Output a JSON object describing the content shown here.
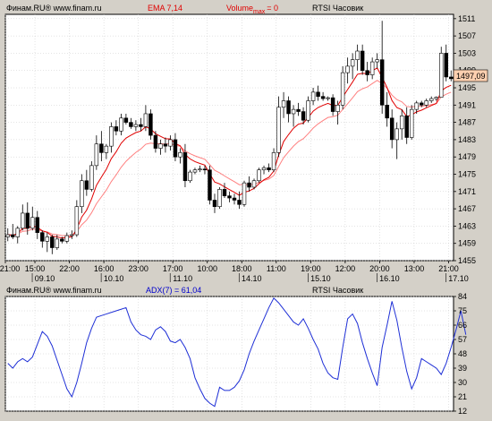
{
  "colors": {
    "background": "#d4d0c8",
    "plot_bg": "#ffffff",
    "grid": "#c8c8c8",
    "candle": "#000000",
    "ema": "#e00000",
    "ema_outer": "#ff8080",
    "adx": "#1e2fd6",
    "header_red": "#e00000",
    "header_blue": "#0000cc",
    "price_marker": "#ffd0b0"
  },
  "chart_data": [
    {
      "type": "candlestick",
      "header": {
        "source": "Финам.RU® www.finam.ru",
        "indicator": "EMA 7,14",
        "volume_prefix": "Volume",
        "volume_sub": "max",
        "volume_suffix": "= 0",
        "instrument": "RTSI Часовик"
      },
      "last_price": "1497,09",
      "ylim": [
        1455,
        1512
      ],
      "yticks": [
        1455,
        1459,
        1463,
        1467,
        1471,
        1475,
        1479,
        1483,
        1487,
        1491,
        1495,
        1499,
        1503,
        1507,
        1511
      ],
      "ytick_labels": [
        "1455",
        "1459",
        "1463",
        "1467",
        "1471",
        "1475",
        "1479",
        "1483",
        "1487",
        "1491",
        "1495",
        "1499",
        "1503",
        "1507",
        "1511"
      ],
      "xticks": [
        "21:00",
        "15:00",
        "22:00",
        "16:00",
        "23:00",
        "17:00",
        "10:00",
        "18:00",
        "11:00",
        "19:00",
        "12:00",
        "20:00",
        "13:00",
        "21:00"
      ],
      "xtick_positions": [
        0,
        6,
        13,
        20,
        27,
        34,
        41,
        48,
        55,
        62,
        69,
        76,
        83,
        90
      ],
      "date_labels": [
        "09.10",
        "10.10",
        "11.10",
        "14.10",
        "15.10",
        "16.10",
        "17.10"
      ],
      "date_positions": [
        8,
        22,
        36,
        50,
        64,
        78,
        92
      ],
      "candles": [
        {
          "o": 1460.5,
          "h": 1462.5,
          "l": 1459.5,
          "c": 1461.0
        },
        {
          "o": 1461.0,
          "h": 1463.5,
          "l": 1460.0,
          "c": 1460.5
        },
        {
          "o": 1460.5,
          "h": 1463.0,
          "l": 1459.0,
          "c": 1462.5
        },
        {
          "o": 1462.5,
          "h": 1468.0,
          "l": 1462.0,
          "c": 1466.0
        },
        {
          "o": 1466.0,
          "h": 1468.5,
          "l": 1461.0,
          "c": 1462.5
        },
        {
          "o": 1462.5,
          "h": 1467.5,
          "l": 1462.0,
          "c": 1465.0
        },
        {
          "o": 1465.0,
          "h": 1466.5,
          "l": 1460.0,
          "c": 1461.5
        },
        {
          "o": 1461.5,
          "h": 1462.0,
          "l": 1458.0,
          "c": 1459.5
        },
        {
          "o": 1459.5,
          "h": 1461.5,
          "l": 1457.0,
          "c": 1460.5
        },
        {
          "o": 1460.5,
          "h": 1461.0,
          "l": 1456.5,
          "c": 1458.0
        },
        {
          "o": 1458.0,
          "h": 1461.0,
          "l": 1457.5,
          "c": 1460.0
        },
        {
          "o": 1460.0,
          "h": 1460.5,
          "l": 1459.0,
          "c": 1459.5
        },
        {
          "o": 1459.5,
          "h": 1461.5,
          "l": 1459.0,
          "c": 1460.8
        },
        {
          "o": 1460.8,
          "h": 1462.0,
          "l": 1460.0,
          "c": 1461.0
        },
        {
          "o": 1461.0,
          "h": 1469.0,
          "l": 1460.5,
          "c": 1467.5
        },
        {
          "o": 1467.5,
          "h": 1475.0,
          "l": 1466.0,
          "c": 1473.5
        },
        {
          "o": 1473.5,
          "h": 1476.0,
          "l": 1470.0,
          "c": 1471.5
        },
        {
          "o": 1471.5,
          "h": 1478.0,
          "l": 1471.0,
          "c": 1477.0
        },
        {
          "o": 1477.0,
          "h": 1484.0,
          "l": 1476.0,
          "c": 1482.0
        },
        {
          "o": 1482.0,
          "h": 1485.0,
          "l": 1478.0,
          "c": 1480.0
        },
        {
          "o": 1480.0,
          "h": 1482.0,
          "l": 1478.5,
          "c": 1481.5
        },
        {
          "o": 1481.5,
          "h": 1487.0,
          "l": 1480.0,
          "c": 1486.0
        },
        {
          "o": 1486.0,
          "h": 1487.5,
          "l": 1484.0,
          "c": 1485.0
        },
        {
          "o": 1485.0,
          "h": 1489.0,
          "l": 1484.0,
          "c": 1488.0
        },
        {
          "o": 1488.0,
          "h": 1489.0,
          "l": 1486.5,
          "c": 1487.0
        },
        {
          "o": 1487.0,
          "h": 1488.0,
          "l": 1485.5,
          "c": 1486.0
        },
        {
          "o": 1486.0,
          "h": 1487.5,
          "l": 1485.0,
          "c": 1486.5
        },
        {
          "o": 1486.5,
          "h": 1488.0,
          "l": 1485.0,
          "c": 1486.0
        },
        {
          "o": 1486.0,
          "h": 1491.0,
          "l": 1485.0,
          "c": 1489.0
        },
        {
          "o": 1489.0,
          "h": 1490.0,
          "l": 1483.0,
          "c": 1484.0
        },
        {
          "o": 1484.0,
          "h": 1485.0,
          "l": 1480.0,
          "c": 1481.0
        },
        {
          "o": 1481.0,
          "h": 1483.0,
          "l": 1479.5,
          "c": 1482.0
        },
        {
          "o": 1482.0,
          "h": 1483.5,
          "l": 1480.0,
          "c": 1481.5
        },
        {
          "o": 1481.5,
          "h": 1484.0,
          "l": 1480.5,
          "c": 1483.0
        },
        {
          "o": 1483.0,
          "h": 1484.5,
          "l": 1478.0,
          "c": 1479.0
        },
        {
          "o": 1479.0,
          "h": 1481.0,
          "l": 1477.5,
          "c": 1480.0
        },
        {
          "o": 1480.0,
          "h": 1482.0,
          "l": 1472.0,
          "c": 1473.5
        },
        {
          "o": 1473.5,
          "h": 1476.0,
          "l": 1473.0,
          "c": 1475.5
        },
        {
          "o": 1475.5,
          "h": 1476.5,
          "l": 1475.0,
          "c": 1476.0
        },
        {
          "o": 1476.0,
          "h": 1477.0,
          "l": 1475.5,
          "c": 1476.2
        },
        {
          "o": 1476.2,
          "h": 1477.0,
          "l": 1475.0,
          "c": 1476.0
        },
        {
          "o": 1476.0,
          "h": 1477.0,
          "l": 1468.0,
          "c": 1469.0
        },
        {
          "o": 1469.0,
          "h": 1470.5,
          "l": 1466.0,
          "c": 1467.5
        },
        {
          "o": 1467.5,
          "h": 1472.0,
          "l": 1467.0,
          "c": 1471.5
        },
        {
          "o": 1471.5,
          "h": 1473.0,
          "l": 1469.5,
          "c": 1470.0
        },
        {
          "o": 1470.0,
          "h": 1471.0,
          "l": 1468.5,
          "c": 1469.5
        },
        {
          "o": 1469.5,
          "h": 1470.5,
          "l": 1468.0,
          "c": 1469.0
        },
        {
          "o": 1469.0,
          "h": 1471.0,
          "l": 1467.0,
          "c": 1468.0
        },
        {
          "o": 1468.0,
          "h": 1473.5,
          "l": 1467.5,
          "c": 1473.0
        },
        {
          "o": 1473.0,
          "h": 1474.5,
          "l": 1471.0,
          "c": 1472.0
        },
        {
          "o": 1472.0,
          "h": 1474.0,
          "l": 1471.5,
          "c": 1473.5
        },
        {
          "o": 1473.5,
          "h": 1476.5,
          "l": 1473.0,
          "c": 1476.0
        },
        {
          "o": 1476.0,
          "h": 1477.0,
          "l": 1475.0,
          "c": 1476.5
        },
        {
          "o": 1476.5,
          "h": 1477.5,
          "l": 1475.5,
          "c": 1476.0
        },
        {
          "o": 1476.0,
          "h": 1481.0,
          "l": 1475.5,
          "c": 1480.0
        },
        {
          "o": 1480.0,
          "h": 1493.0,
          "l": 1479.0,
          "c": 1490.5
        },
        {
          "o": 1490.5,
          "h": 1494.0,
          "l": 1488.0,
          "c": 1492.0
        },
        {
          "o": 1492.0,
          "h": 1493.0,
          "l": 1487.0,
          "c": 1489.0
        },
        {
          "o": 1489.0,
          "h": 1491.0,
          "l": 1486.0,
          "c": 1490.0
        },
        {
          "o": 1490.0,
          "h": 1491.5,
          "l": 1488.5,
          "c": 1489.5
        },
        {
          "o": 1489.5,
          "h": 1490.5,
          "l": 1486.5,
          "c": 1487.5
        },
        {
          "o": 1487.5,
          "h": 1493.0,
          "l": 1487.0,
          "c": 1492.0
        },
        {
          "o": 1492.0,
          "h": 1495.0,
          "l": 1491.0,
          "c": 1494.0
        },
        {
          "o": 1494.0,
          "h": 1495.5,
          "l": 1492.0,
          "c": 1493.0
        },
        {
          "o": 1493.0,
          "h": 1494.0,
          "l": 1492.0,
          "c": 1492.5
        },
        {
          "o": 1492.5,
          "h": 1493.0,
          "l": 1492.0,
          "c": 1492.7
        },
        {
          "o": 1492.7,
          "h": 1493.5,
          "l": 1488.5,
          "c": 1489.5
        },
        {
          "o": 1489.5,
          "h": 1492.0,
          "l": 1486.5,
          "c": 1491.0
        },
        {
          "o": 1491.0,
          "h": 1500.0,
          "l": 1490.0,
          "c": 1498.5
        },
        {
          "o": 1498.5,
          "h": 1502.0,
          "l": 1496.0,
          "c": 1500.0
        },
        {
          "o": 1500.0,
          "h": 1503.0,
          "l": 1497.0,
          "c": 1501.5
        },
        {
          "o": 1501.5,
          "h": 1505.0,
          "l": 1499.0,
          "c": 1503.5
        },
        {
          "o": 1503.5,
          "h": 1505.0,
          "l": 1498.0,
          "c": 1499.0
        },
        {
          "o": 1499.0,
          "h": 1501.0,
          "l": 1496.5,
          "c": 1498.0
        },
        {
          "o": 1498.0,
          "h": 1502.0,
          "l": 1497.0,
          "c": 1501.0
        },
        {
          "o": 1501.0,
          "h": 1503.0,
          "l": 1499.5,
          "c": 1501.5
        },
        {
          "o": 1501.5,
          "h": 1510.5,
          "l": 1489.0,
          "c": 1491.0
        },
        {
          "o": 1491.0,
          "h": 1494.0,
          "l": 1486.0,
          "c": 1488.0
        },
        {
          "o": 1488.0,
          "h": 1490.0,
          "l": 1481.0,
          "c": 1483.0
        },
        {
          "o": 1483.0,
          "h": 1487.0,
          "l": 1478.5,
          "c": 1485.5
        },
        {
          "o": 1485.5,
          "h": 1490.0,
          "l": 1483.0,
          "c": 1488.5
        },
        {
          "o": 1488.5,
          "h": 1490.5,
          "l": 1482.0,
          "c": 1483.5
        },
        {
          "o": 1483.5,
          "h": 1491.0,
          "l": 1483.0,
          "c": 1490.0
        },
        {
          "o": 1490.0,
          "h": 1492.0,
          "l": 1489.0,
          "c": 1491.5
        },
        {
          "o": 1491.5,
          "h": 1492.0,
          "l": 1490.5,
          "c": 1491.0
        },
        {
          "o": 1491.0,
          "h": 1492.5,
          "l": 1490.5,
          "c": 1492.0
        },
        {
          "o": 1492.0,
          "h": 1493.0,
          "l": 1491.5,
          "c": 1492.5
        },
        {
          "o": 1492.5,
          "h": 1493.0,
          "l": 1492.0,
          "c": 1492.8
        },
        {
          "o": 1492.8,
          "h": 1504.5,
          "l": 1496.0,
          "c": 1503.0
        },
        {
          "o": 1503.0,
          "h": 1505.0,
          "l": 1496.5,
          "c": 1497.5
        },
        {
          "o": 1497.5,
          "h": 1499.0,
          "l": 1496.5,
          "c": 1497.1
        }
      ]
    },
    {
      "type": "line",
      "header": {
        "source": "Финам.RU® www.finam.ru",
        "indicator": "ADX(7) = 61,04",
        "instrument": "RTSI Часовик"
      },
      "ylim": [
        12,
        84
      ],
      "yticks": [
        12,
        21,
        30,
        39,
        48,
        57,
        66,
        75,
        84
      ],
      "ytick_labels": [
        "12",
        "21",
        "30",
        "39",
        "48",
        "57",
        "66",
        "75",
        "84"
      ],
      "series": [
        {
          "values": [
            42,
            39,
            43,
            45,
            43,
            46,
            54,
            62,
            59,
            53,
            44,
            35,
            26,
            21,
            30,
            42,
            55,
            64,
            71,
            72,
            73,
            74,
            75,
            76,
            77,
            68,
            63,
            60,
            59,
            57,
            63,
            65,
            62,
            56,
            55,
            57,
            52,
            45,
            33,
            26,
            20,
            17,
            15,
            27,
            25,
            25,
            27,
            31,
            38,
            48,
            56,
            63,
            70,
            77,
            83,
            80,
            76,
            72,
            68,
            66,
            70,
            64,
            57,
            51,
            42,
            36,
            33,
            32,
            52,
            70,
            73,
            67,
            55,
            45,
            36,
            28,
            52,
            66,
            81,
            69,
            52,
            37,
            26,
            33,
            45,
            43,
            41,
            39,
            35,
            42,
            52,
            63,
            75,
            60
          ]
        }
      ]
    }
  ]
}
